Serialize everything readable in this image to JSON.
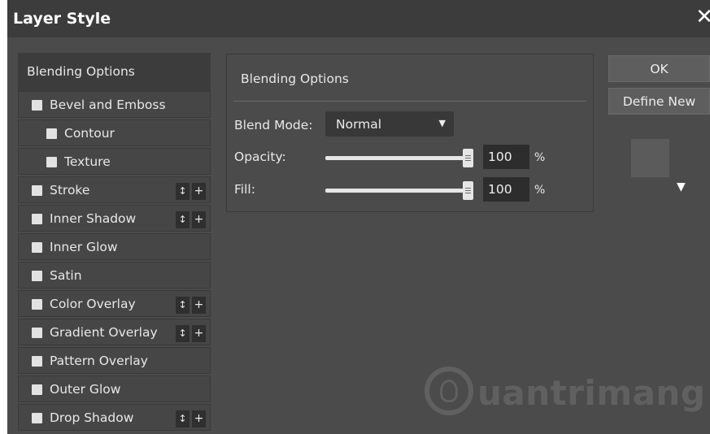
{
  "window": {
    "title": "Layer Style"
  },
  "icons": {
    "close": "close-icon",
    "preview_arrow": "triangle-down-icon"
  },
  "styles_list": {
    "header": "Blending Options",
    "items": [
      {
        "label": "Bevel and Emboss"
      },
      {
        "label": "Contour"
      },
      {
        "label": "Texture"
      },
      {
        "label": "Stroke"
      },
      {
        "label": "Inner Shadow"
      },
      {
        "label": "Inner Glow"
      },
      {
        "label": "Satin"
      },
      {
        "label": "Color Overlay"
      },
      {
        "label": "Gradient Overlay"
      },
      {
        "label": "Pattern Overlay"
      },
      {
        "label": "Outer Glow"
      },
      {
        "label": "Drop Shadow"
      }
    ],
    "mini_up": "↕",
    "mini_add": "+"
  },
  "panel": {
    "title": "Blending Options",
    "blend_mode_label": "Blend Mode:",
    "blend_mode_value": "Normal",
    "blend_mode_arrow": "▼",
    "opacity_label": "Opacity:",
    "opacity_value": "100",
    "fill_label": "Fill:",
    "fill_value": "100",
    "percent": "%"
  },
  "buttons": {
    "ok": "OK",
    "define_new": "Define New"
  },
  "watermark": {
    "text": "uantrimang"
  },
  "colors": {
    "dialog_bg": "#4b4b4b",
    "titlebar_bg": "#3c3c3c",
    "field_bg": "#2d2d2d",
    "text": "#e8e8e8",
    "button_bg": "#5e5e5e"
  }
}
